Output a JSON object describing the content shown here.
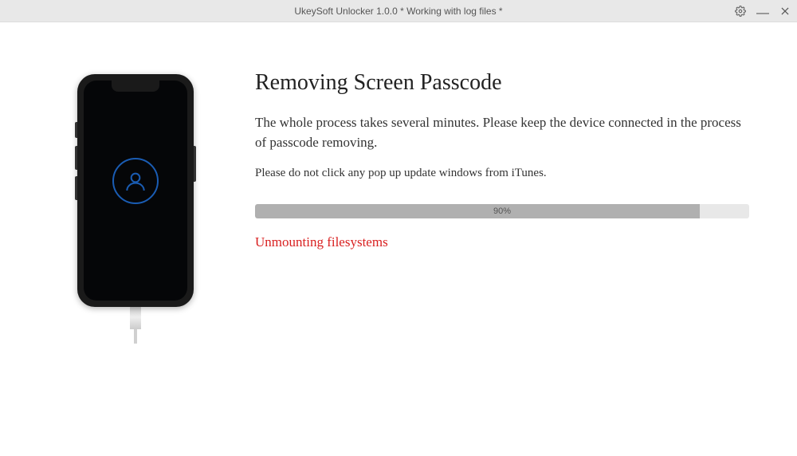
{
  "titlebar": {
    "text": "UkeySoft Unlocker 1.0.0 * Working with log files *"
  },
  "main": {
    "heading": "Removing Screen Passcode",
    "description": "The whole process takes several minutes. Please keep the device connected in the process of passcode removing.",
    "warning": "Please do not click any pop up update windows from iTunes.",
    "progress_percent": 90,
    "progress_label": "90%",
    "status": "Unmounting filesystems"
  }
}
